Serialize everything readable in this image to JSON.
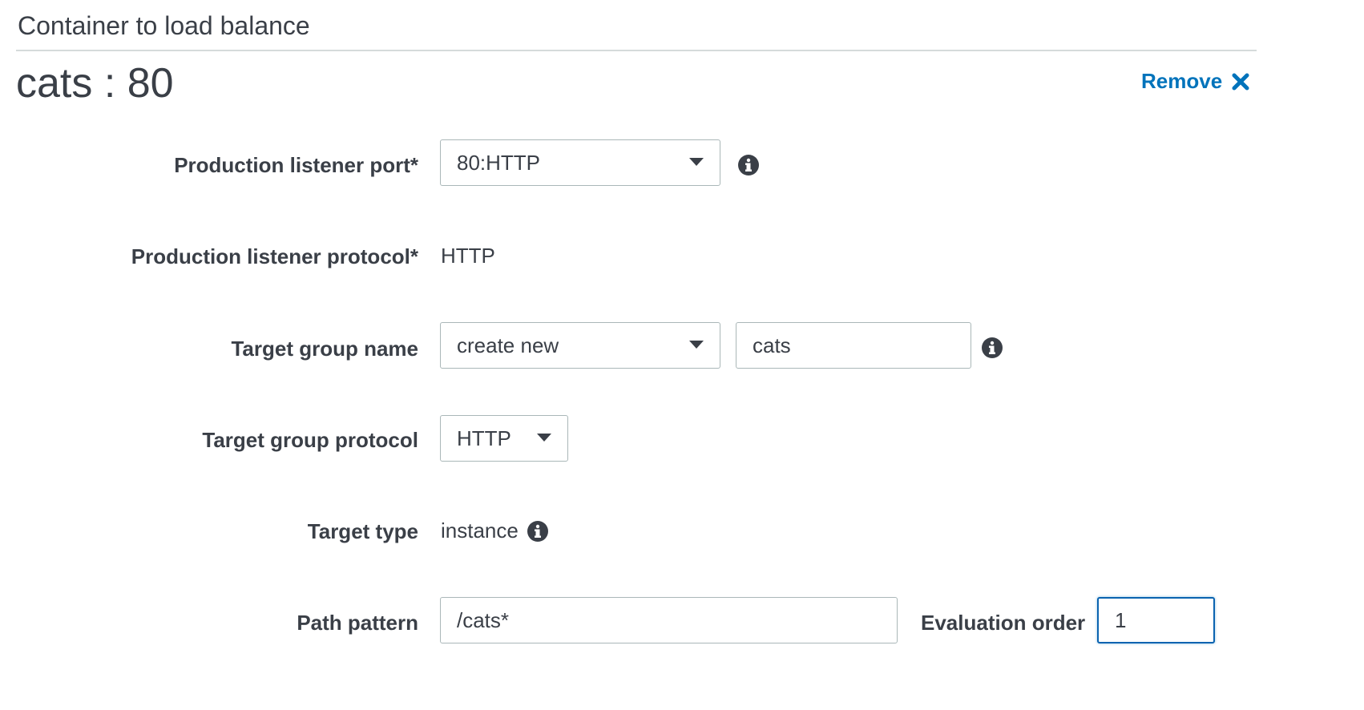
{
  "header": {
    "section_title": "Container to load balance",
    "page_title": "cats : 80",
    "remove_label": "Remove"
  },
  "form": {
    "production_listener_port": {
      "label": "Production listener port*",
      "value": "80:HTTP"
    },
    "production_listener_protocol": {
      "label": "Production listener protocol*",
      "value": "HTTP"
    },
    "target_group_name": {
      "label": "Target group name",
      "select_value": "create new",
      "input_value": "cats"
    },
    "target_group_protocol": {
      "label": "Target group protocol",
      "value": "HTTP"
    },
    "target_type": {
      "label": "Target type",
      "value": "instance"
    },
    "path_pattern": {
      "label": "Path pattern",
      "value": "/cats*"
    },
    "evaluation_order": {
      "label": "Evaluation order",
      "value": "1"
    }
  },
  "icons": {
    "info": "info-circle-icon",
    "remove": "close-x-icon",
    "dropdown": "caret-down-icon"
  },
  "colors": {
    "link": "#0073bb",
    "text": "#3a3f47",
    "border": "#aab7b8",
    "focus": "#0a63b0"
  }
}
